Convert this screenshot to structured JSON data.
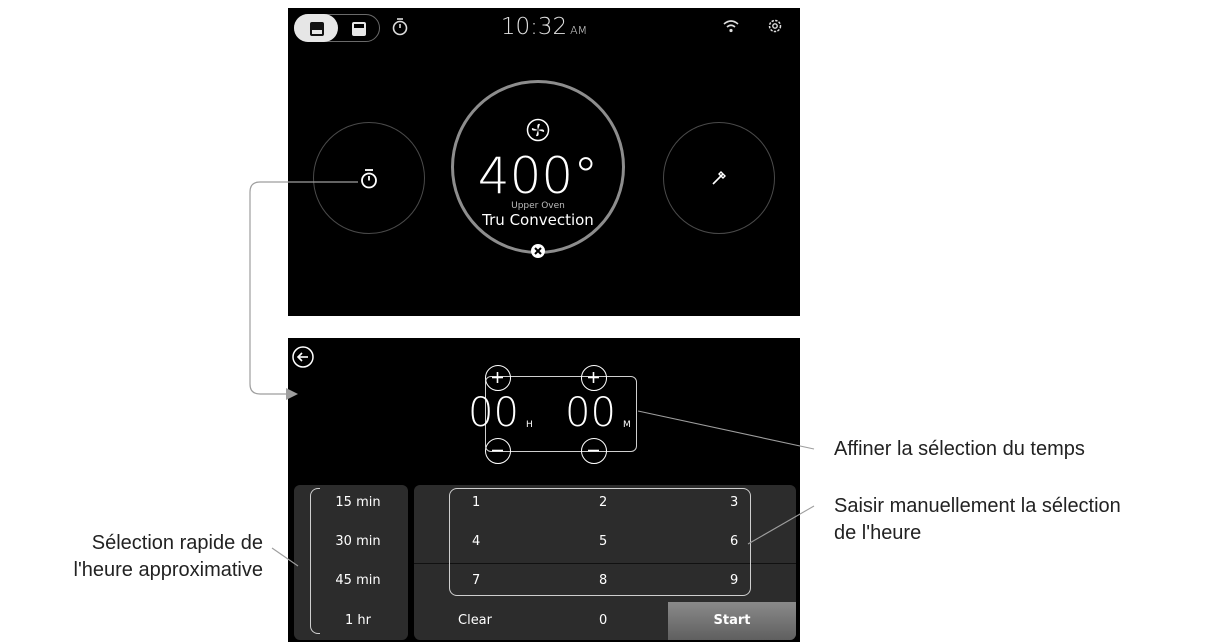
{
  "top_screen": {
    "clock": {
      "time": "10:32",
      "ampm": "AM"
    },
    "temperature": "400°",
    "oven_label": "Upper Oven",
    "mode": "Tru Convection"
  },
  "bottom_screen": {
    "hours": "00",
    "hours_unit": "H",
    "minutes": "00",
    "minutes_unit": "M",
    "quick_times": [
      "15 min",
      "30 min",
      "45 min",
      "1 hr"
    ],
    "keypad": [
      "1",
      "2",
      "3",
      "4",
      "5",
      "6",
      "7",
      "8",
      "9"
    ],
    "clear_label": "Clear",
    "zero_label": "0",
    "start_label": "Start"
  },
  "annotations": {
    "fine_tune": "Affiner la sélection du temps",
    "manual_entry_1": "Saisir manuellement la sélection",
    "manual_entry_2": "de l'heure",
    "quick_select_1": "Sélection rapide de",
    "quick_select_2": "l'heure approximative"
  },
  "colors": {
    "screen_bg": "#000000",
    "panel_bg": "#2c2c2c",
    "start_bg": "#6f6f6f",
    "connector": "#9e9e9e"
  }
}
